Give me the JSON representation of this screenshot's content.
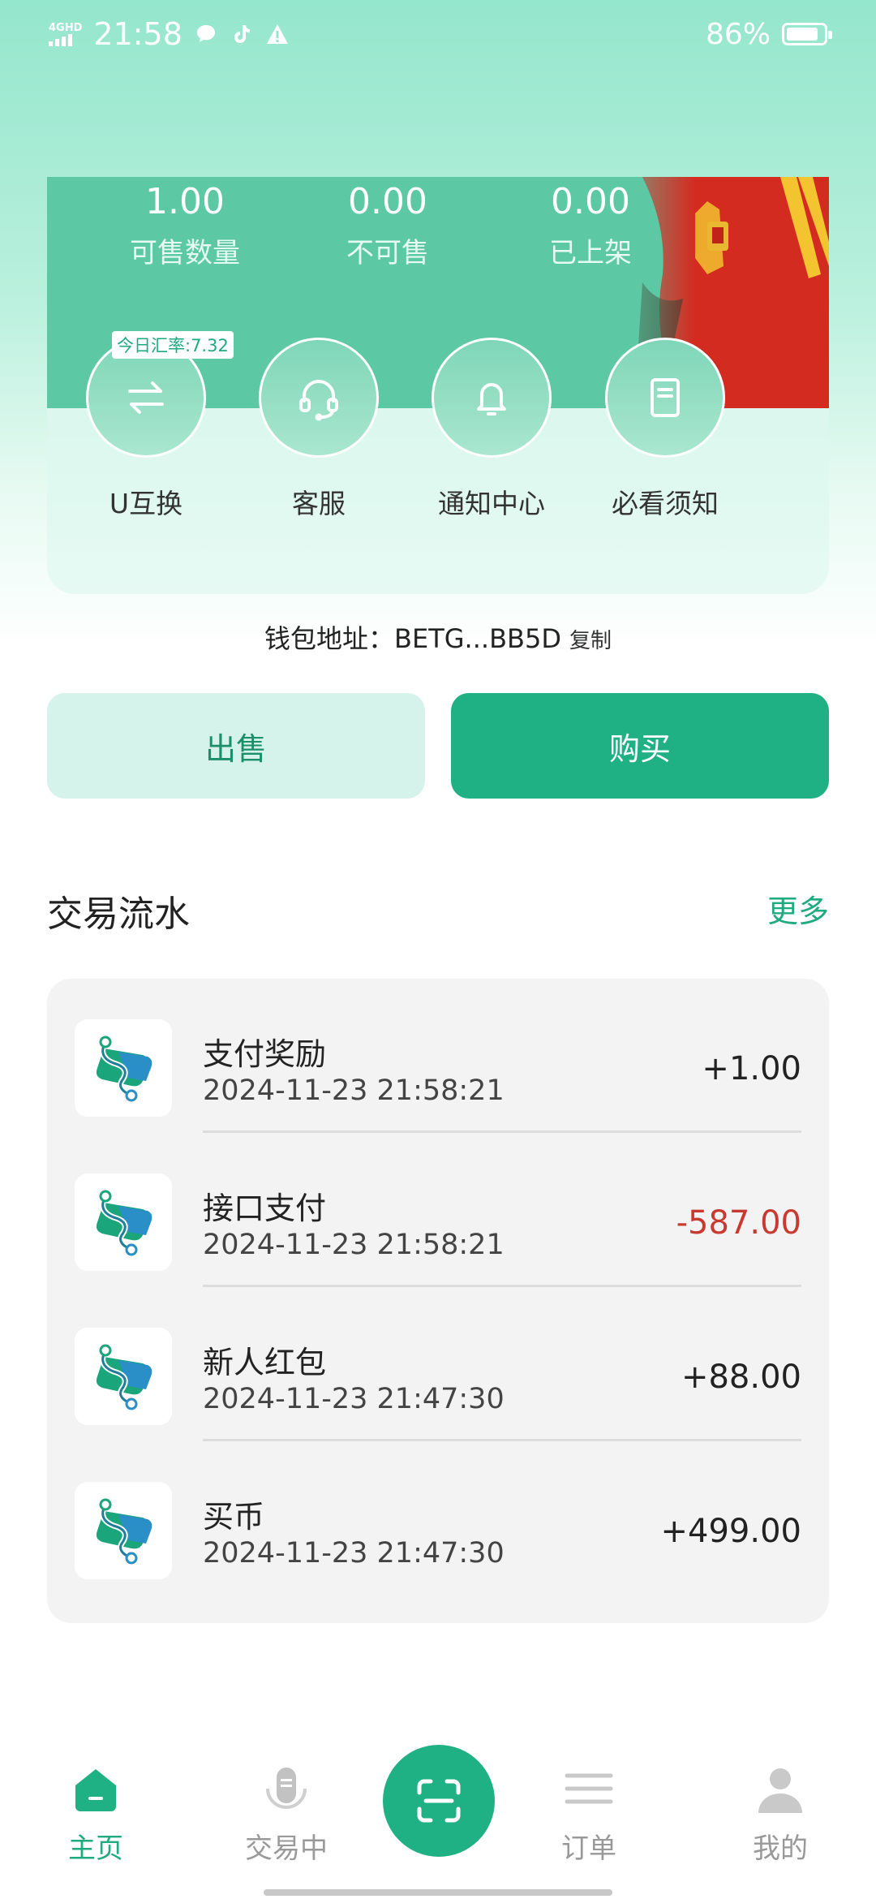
{
  "status_bar": {
    "network": "4GHD",
    "time": "21:58",
    "battery_percent": "86%",
    "battery_level": 0.86,
    "icons": [
      "message-icon",
      "tiktok-icon",
      "warning-icon"
    ]
  },
  "banner": {
    "stats": [
      {
        "value": "1.00",
        "label": "可售数量"
      },
      {
        "value": "0.00",
        "label": "不可售"
      },
      {
        "value": "0.00",
        "label": "已上架"
      }
    ],
    "rate_badge": "今日汇率:7.32",
    "actions": [
      {
        "label": "U互换",
        "icon": "swap-icon"
      },
      {
        "label": "客服",
        "icon": "headset-icon"
      },
      {
        "label": "通知中心",
        "icon": "bell-icon"
      },
      {
        "label": "必看须知",
        "icon": "book-icon"
      }
    ]
  },
  "wallet": {
    "label": "钱包地址：",
    "address": "BETG...BB5D",
    "copy": "复制"
  },
  "buttons": {
    "sell": "出售",
    "buy": "购买"
  },
  "transactions": {
    "title": "交易流水",
    "more": "更多",
    "items": [
      {
        "name": "支付奖励",
        "time": "2024-11-23 21:58:21",
        "amount": "+1.00",
        "negative": false
      },
      {
        "name": "接口支付",
        "time": "2024-11-23 21:58:21",
        "amount": "-587.00",
        "negative": true
      },
      {
        "name": "新人红包",
        "time": "2024-11-23 21:47:30",
        "amount": "+88.00",
        "negative": false
      },
      {
        "name": "买币",
        "time": "2024-11-23 21:47:30",
        "amount": "+499.00",
        "negative": false
      }
    ]
  },
  "tab_bar": {
    "items": [
      {
        "label": "主页",
        "icon": "home-icon",
        "active": true
      },
      {
        "label": "交易中",
        "icon": "microphone-icon",
        "active": false
      },
      {
        "label": "",
        "icon": "scan-icon",
        "active": false
      },
      {
        "label": "订单",
        "icon": "list-icon",
        "active": false
      },
      {
        "label": "我的",
        "icon": "user-icon",
        "active": false
      }
    ]
  },
  "colors": {
    "accent": "#1fb084",
    "negative": "#c8392f",
    "gradient_top": "#94e6cc"
  }
}
